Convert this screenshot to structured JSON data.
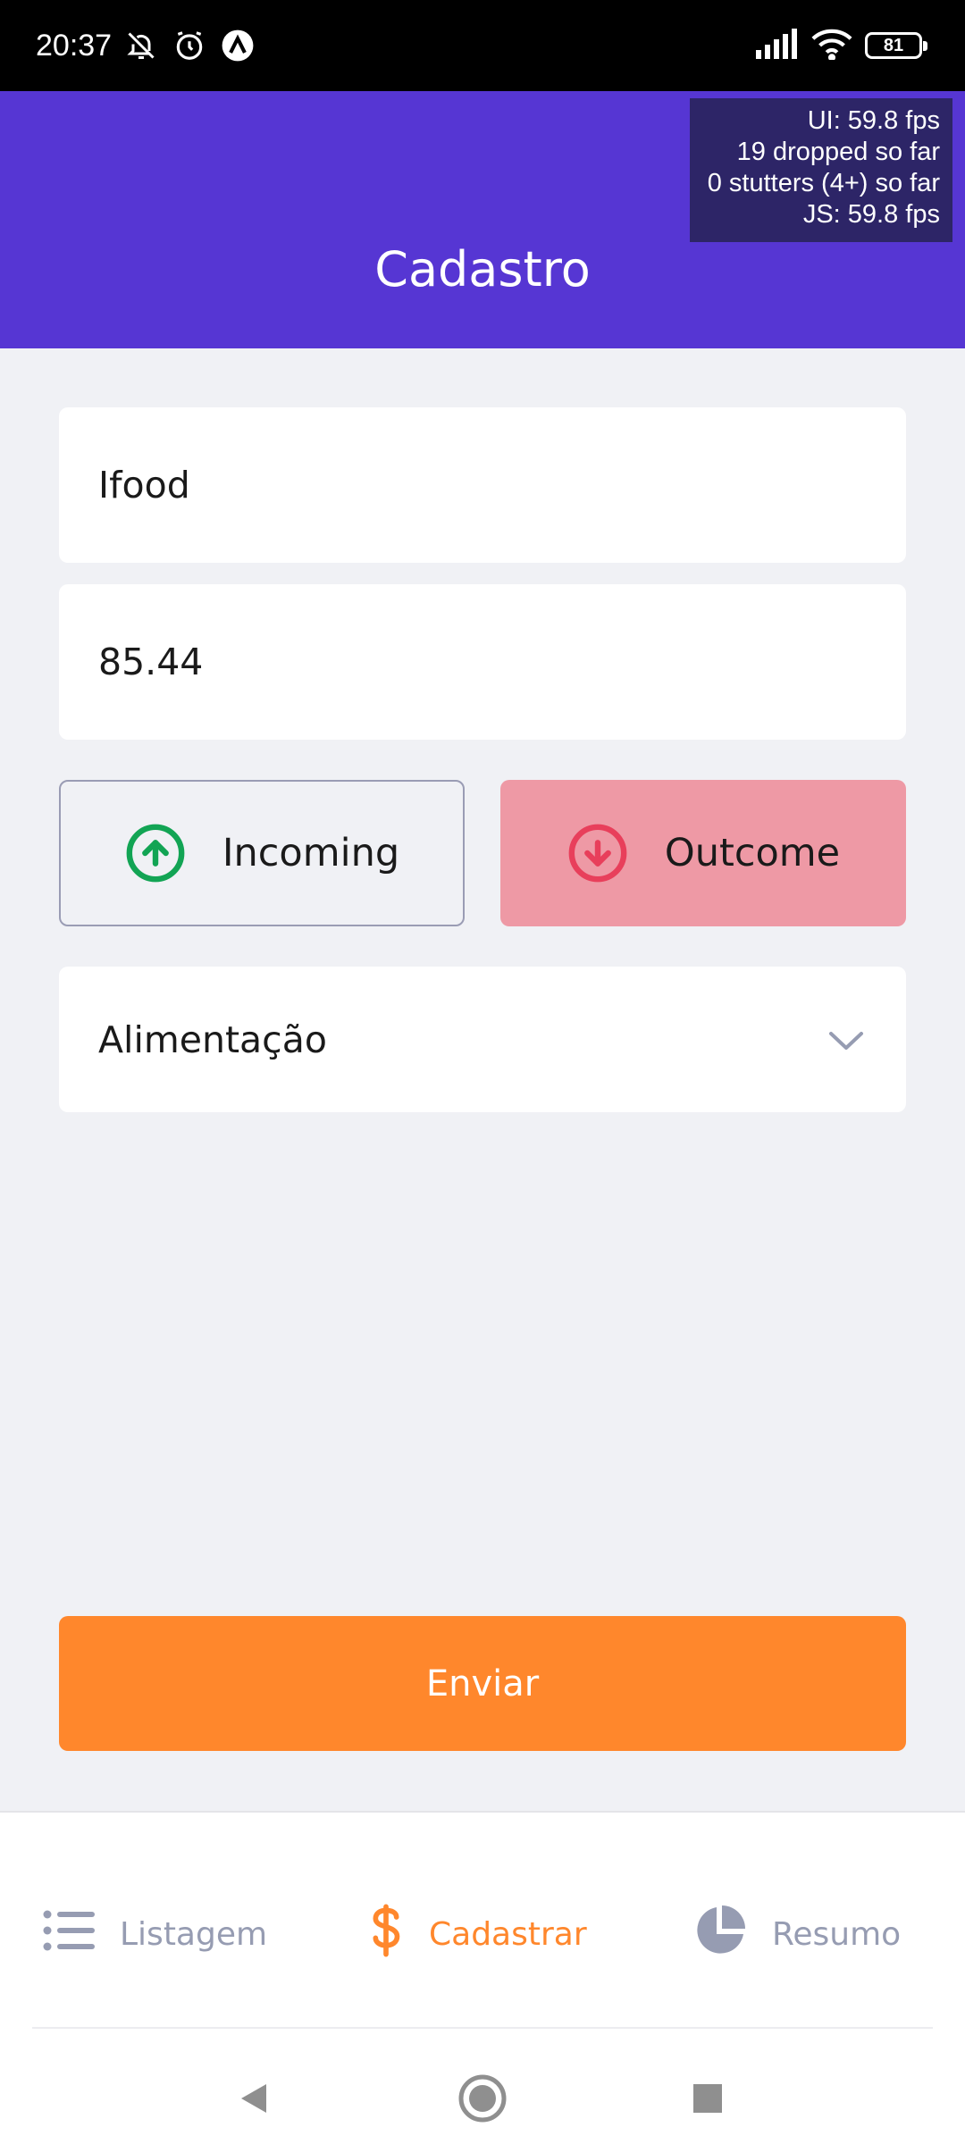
{
  "status_bar": {
    "time": "20:37",
    "battery": "81",
    "icons": [
      "mute-bell-icon",
      "alarm-icon",
      "app-icon",
      "signal-icon",
      "wifi-icon",
      "battery-icon"
    ]
  },
  "perf_overlay": {
    "ui_fps": "UI: 59.8 fps",
    "dropped": "19 dropped so far",
    "stutters": "0 stutters (4+) so far",
    "js_fps": "JS: 59.8 fps"
  },
  "header": {
    "title": "Cadastro"
  },
  "form": {
    "name_value": "Ifood",
    "amount_value": "85.44",
    "incoming_label": "Incoming",
    "outcome_label": "Outcome",
    "category_value": "Alimentação",
    "submit_label": "Enviar",
    "selected_type": "outcome"
  },
  "tabs": [
    {
      "label": "Listagem",
      "icon": "list-icon",
      "active": false
    },
    {
      "label": "Cadastrar",
      "icon": "dollar-icon",
      "active": true
    },
    {
      "label": "Resumo",
      "icon": "pie-chart-icon",
      "active": false
    }
  ],
  "colors": {
    "primary": "#5636d3",
    "accent": "#ff872c",
    "success": "#12a454",
    "attention": "#e83f5b",
    "outcome_selected_bg": "#ee99a5",
    "inactive_text": "#969cb2",
    "background": "#f0f1f5"
  }
}
